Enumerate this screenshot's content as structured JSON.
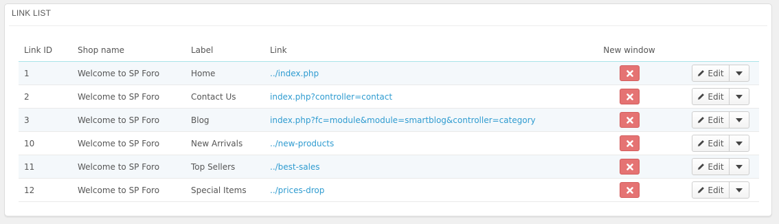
{
  "panel": {
    "title": "LINK LIST"
  },
  "table": {
    "headers": {
      "id": "Link ID",
      "shop": "Shop name",
      "label": "Label",
      "link": "Link",
      "new_window": "New window"
    },
    "rows": [
      {
        "id": "1",
        "shop": "Welcome to SP Foro",
        "label": "Home",
        "link": "../index.php",
        "new_window": false
      },
      {
        "id": "2",
        "shop": "Welcome to SP Foro",
        "label": "Contact Us",
        "link": "index.php?controller=contact",
        "new_window": false
      },
      {
        "id": "3",
        "shop": "Welcome to SP Foro",
        "label": "Blog",
        "link": "index.php?fc=module&module=smartblog&controller=category",
        "new_window": false
      },
      {
        "id": "10",
        "shop": "Welcome to SP Foro",
        "label": "New Arrivals",
        "link": "../new-products",
        "new_window": false
      },
      {
        "id": "11",
        "shop": "Welcome to SP Foro",
        "label": "Top Sellers",
        "link": "../best-sales",
        "new_window": false
      },
      {
        "id": "12",
        "shop": "Welcome to SP Foro",
        "label": "Special Items",
        "link": "../prices-drop",
        "new_window": false
      }
    ],
    "actions": {
      "edit_label": "Edit"
    }
  },
  "colors": {
    "link": "#2e9bd0",
    "danger": "#e57373",
    "header_rule": "#a8e3e8",
    "row_alt": "#f4f8fb"
  },
  "icons": {
    "new_window_off": "close-icon",
    "edit": "pencil-icon",
    "dropdown": "caret-down-icon"
  }
}
